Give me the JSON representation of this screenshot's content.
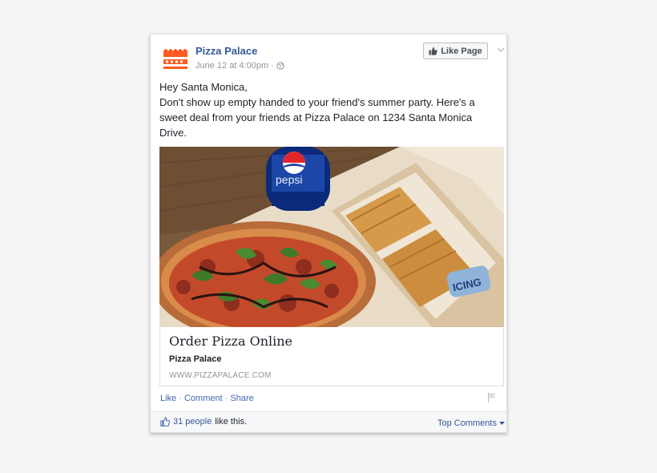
{
  "post": {
    "page_name": "Pizza Palace",
    "date": "June 12 at 4:00pm",
    "meta_sep": "·",
    "like_page": "Like Page",
    "text_lines": [
      "Hey Santa Monica,",
      "Don't show up empty handed to your friend's summer party. Here's a",
      "sweet deal from your friends at Pizza Palace on 1234 Santa Monica",
      "Drive."
    ],
    "image_text": {
      "bottle": "pepsi",
      "tin": "ICING"
    },
    "link": {
      "title": "Order Pizza Online",
      "source": "Pizza Palace",
      "url": "WWW.PIZZAPALACE.COM"
    },
    "actions": {
      "like": "Like",
      "comment": "Comment",
      "share": "Share",
      "sep": " · "
    },
    "footer": {
      "count_link": "31 people",
      "like_text": "like this.",
      "top_comments": "Top Comments"
    }
  },
  "colors": {
    "brand": "#ff5a1f",
    "link": "#365899",
    "muted": "#90949c"
  },
  "icons": [
    "pizza-palace-logo",
    "globe-icon",
    "thumbs-up-icon",
    "chevron-down-icon",
    "flag-icon",
    "caret-down-icon"
  ]
}
